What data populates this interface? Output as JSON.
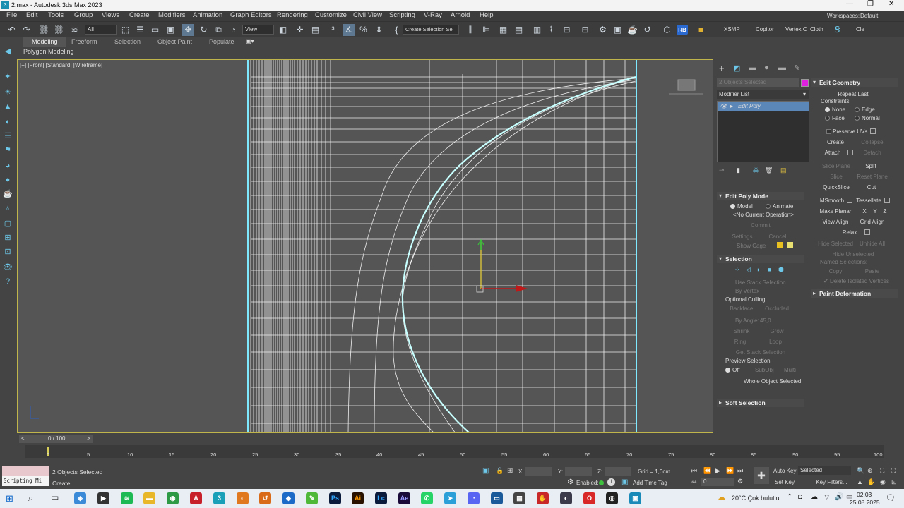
{
  "window": {
    "title": "2.max - Autodesk 3ds Max 2023",
    "workspaces_label": "Workspaces:",
    "workspace": "Default"
  },
  "menu": [
    "File",
    "Edit",
    "Tools",
    "Group",
    "Views",
    "Create",
    "Modifiers",
    "Animation",
    "Graph Editors",
    "Rendering",
    "Customize",
    "Civil View",
    "Scripting",
    "V-Ray",
    "Arnold",
    "Help"
  ],
  "toolbar": {
    "filter": "All",
    "view": "View",
    "selection_set": "Create Selection Se",
    "right_labels": [
      "XSMP",
      "Copitor",
      "Vertex C",
      "Cloth",
      "Cle"
    ],
    "rb": "RB"
  },
  "ribbon": {
    "tabs": [
      "Modeling",
      "Freeform",
      "Selection",
      "Object Paint",
      "Populate"
    ],
    "sub": "Polygon Modeling"
  },
  "viewport": {
    "label": "[+] [Front] [Standard] [Wireframe]"
  },
  "cmd": {
    "objects_selected": "2 Objects Selected",
    "modifier_list": "Modifier List",
    "stack_item": "Edit Poly",
    "edit_poly_mode": "Edit Poly Mode",
    "model": "Model",
    "animate": "Animate",
    "no_op": "<No Current Operation>",
    "commit": "Commit",
    "settings": "Settings",
    "cancel": "Cancel",
    "show_cage": "Show Cage",
    "selection": "Selection",
    "use_stack": "Use Stack Selection",
    "by_vertex": "By Vertex",
    "optional_culling": "Optional Culling",
    "backface": "Backface",
    "occluded": "Occluded",
    "by_angle": "By Angle:",
    "angle_value": "45,0",
    "shrink": "Shrink",
    "grow": "Grow",
    "ring": "Ring",
    "loop": "Loop",
    "get_stack": "Get Stack Selection",
    "preview_selection": "Preview Selection",
    "off": "Off",
    "subobj": "SubObj",
    "multi": "Multi",
    "whole_object": "Whole Object Selected",
    "soft_selection": "Soft Selection"
  },
  "edit_geometry": {
    "title": "Edit Geometry",
    "repeat_last": "Repeat Last",
    "constraints": "Constraints",
    "none": "None",
    "edge": "Edge",
    "face": "Face",
    "normal": "Normal",
    "preserve_uvs": "Preserve UVs",
    "create": "Create",
    "collapse": "Collapse",
    "attach": "Attach",
    "detach": "Detach",
    "slice_plane": "Slice Plane",
    "split": "Split",
    "slice": "Slice",
    "reset_plane": "Reset Plane",
    "quickslice": "QuickSlice",
    "cut": "Cut",
    "msmooth": "MSmooth",
    "tessellate": "Tessellate",
    "make_planar": "Make Planar",
    "x": "X",
    "y": "Y",
    "z": "Z",
    "view_align": "View Align",
    "grid_align": "Grid Align",
    "relax": "Relax",
    "hide_selected": "Hide Selected",
    "unhide_all": "Unhide All",
    "hide_unselected": "Hide Unselected",
    "named_selections": "Named Selections:",
    "copy": "Copy",
    "paste": "Paste",
    "delete_isolated": "Delete Isolated Vertices",
    "paint_deformation": "Paint Deformation"
  },
  "timeline": {
    "frame": "0 / 100",
    "ticks": [
      "0",
      "5",
      "10",
      "15",
      "20",
      "25",
      "30",
      "35",
      "40",
      "45",
      "50",
      "55",
      "60",
      "65",
      "70",
      "75",
      "80",
      "85",
      "90",
      "95",
      "100"
    ]
  },
  "status": {
    "selected": "2 Objects Selected",
    "script": "Scripting Mi",
    "create": "Create",
    "x": "X:",
    "y": "Y:",
    "z": "Z:",
    "grid": "Grid = 1,0cm",
    "enabled": "Enabled:",
    "add_time_tag": "Add Time Tag",
    "auto_key": "Auto Key",
    "set_key": "Set Key",
    "selected_dd": "Selected",
    "key_filters": "Key Filters...",
    "frame_value": "0"
  },
  "taskbar": {
    "weather": "20°C  Çok bulutlu",
    "time": "02:03",
    "date": "25.08.2025"
  },
  "colors": {
    "accent": "#6cc7e8",
    "object_color": "#e020e0",
    "viewport_bg": "#555555",
    "wire": "#ffffff",
    "selected_wire": "#c8ffff"
  }
}
